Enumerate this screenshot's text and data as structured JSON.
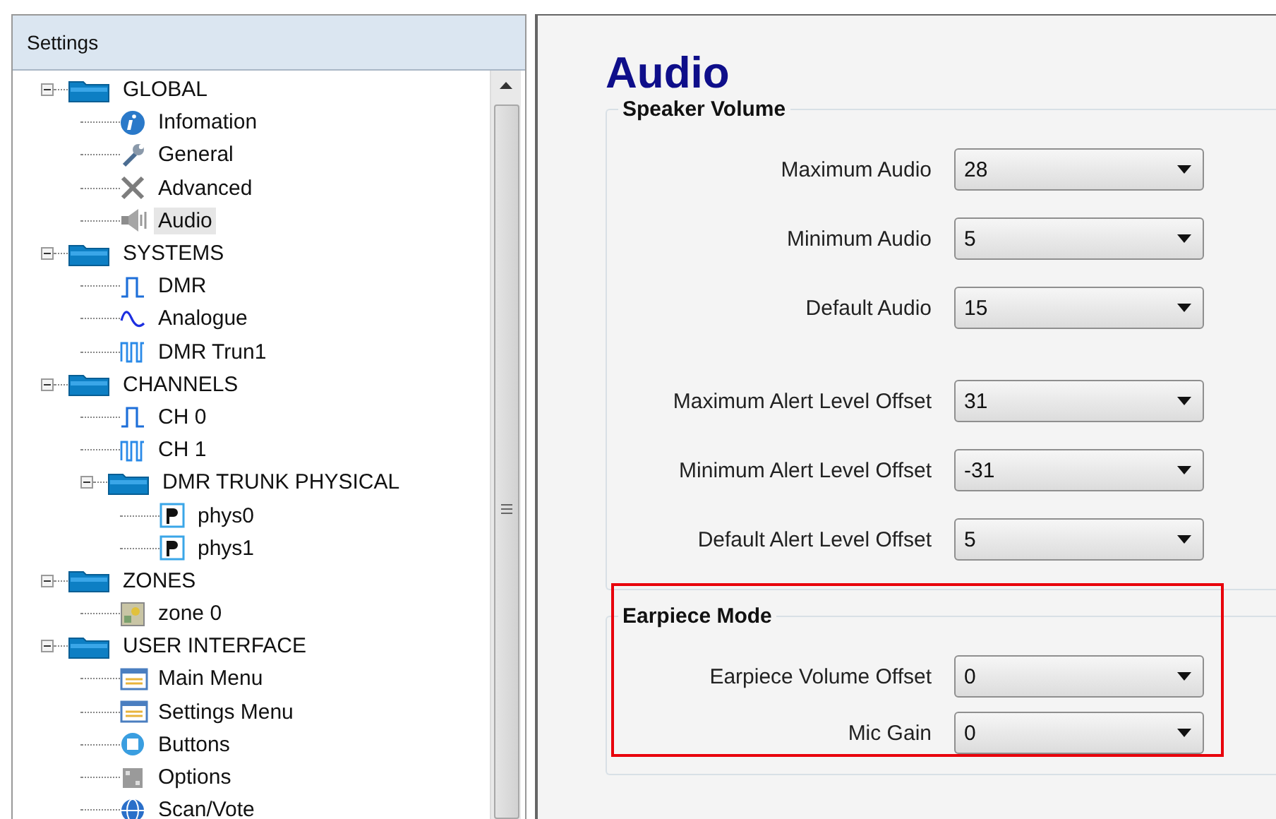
{
  "panel": {
    "title": "Settings"
  },
  "tree": [
    {
      "label": "GLOBAL",
      "kind": "folder",
      "expanded": true,
      "selected": false,
      "children": [
        {
          "label": "Infomation",
          "kind": "info",
          "selected": false
        },
        {
          "label": "General",
          "kind": "wrench",
          "selected": false
        },
        {
          "label": "Advanced",
          "kind": "tools",
          "selected": false
        },
        {
          "label": "Audio",
          "kind": "speaker",
          "selected": true
        }
      ]
    },
    {
      "label": "SYSTEMS",
      "kind": "folder",
      "expanded": true,
      "selected": false,
      "children": [
        {
          "label": "DMR",
          "kind": "pulse",
          "selected": false
        },
        {
          "label": "Analogue",
          "kind": "wave",
          "selected": false
        },
        {
          "label": "DMR Trun1",
          "kind": "pulses",
          "selected": false
        }
      ]
    },
    {
      "label": "CHANNELS",
      "kind": "folder",
      "expanded": true,
      "selected": false,
      "children": [
        {
          "label": "CH 0",
          "kind": "pulse",
          "selected": false
        },
        {
          "label": "CH 1",
          "kind": "pulses",
          "selected": false
        },
        {
          "label": "DMR TRUNK PHYSICAL",
          "kind": "folder",
          "expanded": true,
          "selected": false,
          "children": [
            {
              "label": "phys0",
              "kind": "letter",
              "selected": false
            },
            {
              "label": "phys1",
              "kind": "letter",
              "selected": false
            }
          ]
        }
      ]
    },
    {
      "label": "ZONES",
      "kind": "folder",
      "expanded": true,
      "selected": false,
      "children": [
        {
          "label": "zone 0",
          "kind": "map",
          "selected": false
        }
      ]
    },
    {
      "label": "USER INTERFACE",
      "kind": "folder",
      "expanded": true,
      "selected": false,
      "children": [
        {
          "label": "Main Menu",
          "kind": "menu",
          "selected": false
        },
        {
          "label": "Settings Menu",
          "kind": "menu",
          "selected": false
        },
        {
          "label": "Buttons",
          "kind": "gear",
          "selected": false
        },
        {
          "label": "Options",
          "kind": "grid",
          "selected": false
        },
        {
          "label": "Scan/Vote",
          "kind": "globe",
          "selected": false
        }
      ]
    }
  ],
  "page": {
    "title": "Audio",
    "sections": [
      {
        "title": "Speaker Volume",
        "highlighted": false,
        "field_groups": [
          {
            "fields": [
              {
                "label": "Maximum Audio",
                "value": "28"
              },
              {
                "label": "Minimum Audio",
                "value": "5"
              },
              {
                "label": "Default Audio",
                "value": "15"
              }
            ]
          },
          {
            "fields": [
              {
                "label": "Maximum Alert Level Offset",
                "value": "31"
              },
              {
                "label": "Minimum Alert Level Offset",
                "value": "-31"
              },
              {
                "label": "Default Alert Level Offset",
                "value": "5"
              }
            ]
          }
        ]
      },
      {
        "title": "Earpiece Mode",
        "highlighted": true,
        "field_groups": [
          {
            "fields": [
              {
                "label": "Earpiece Volume Offset",
                "value": "0"
              },
              {
                "label": "Mic Gain",
                "value": "0"
              }
            ]
          }
        ]
      }
    ]
  }
}
